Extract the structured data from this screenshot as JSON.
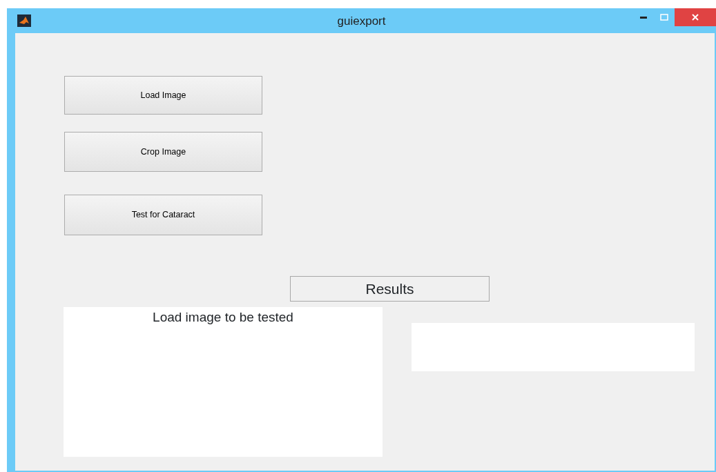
{
  "window": {
    "title": "guiexport"
  },
  "buttons": [
    {
      "label": "Load Image"
    },
    {
      "label": "Crop Image"
    },
    {
      "label": "Test for Cataract"
    }
  ],
  "results_label": "Results",
  "image_panel": {
    "text": "Load image to be tested"
  }
}
